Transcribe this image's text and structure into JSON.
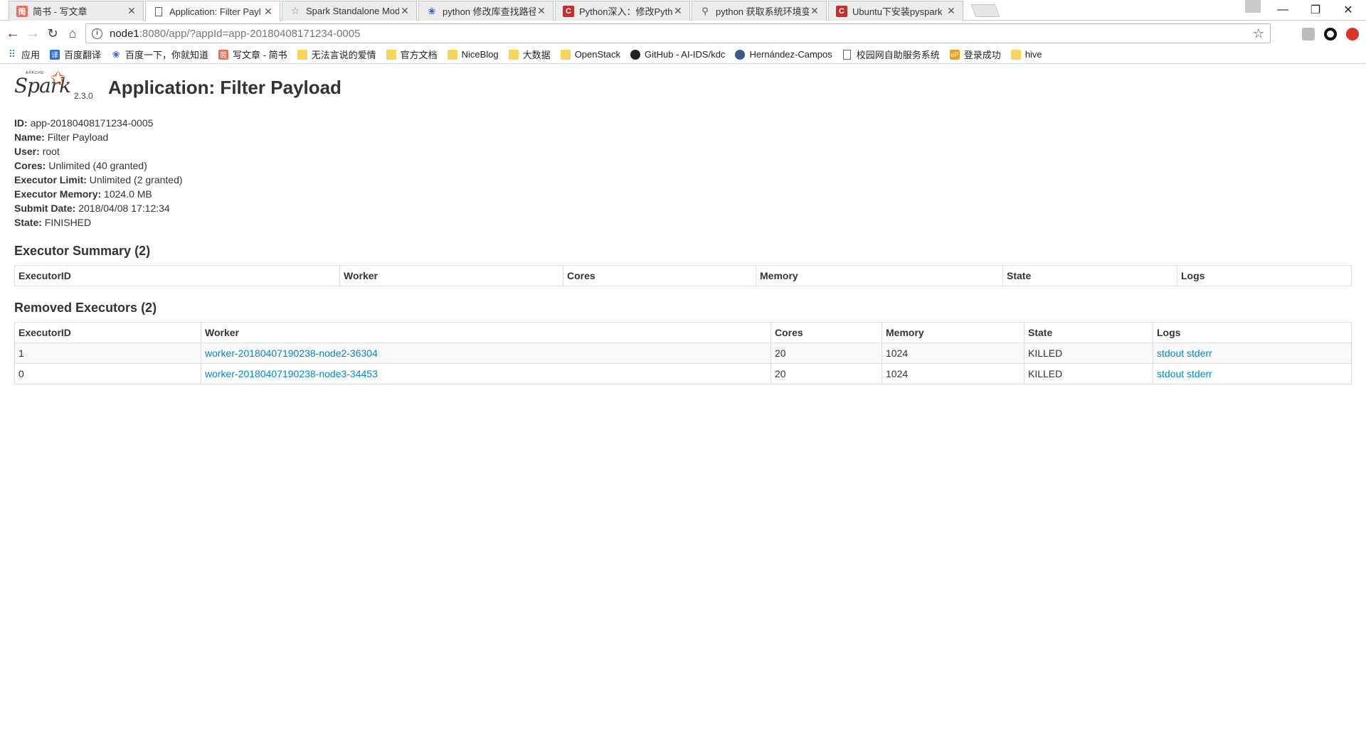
{
  "browser": {
    "tabs": [
      {
        "title": "简书 - 写文章",
        "favicon": "jianshu-icon",
        "active": false
      },
      {
        "title": "Application: Filter Payl",
        "favicon": "document-icon",
        "active": true
      },
      {
        "title": "Spark Standalone Mod",
        "favicon": "spark-star-icon",
        "active": false
      },
      {
        "title": "python 修改库查找路径",
        "favicon": "baidu-paw-icon",
        "active": false
      },
      {
        "title": "Python深入：修改Pytho",
        "favicon": "csdn-icon",
        "active": false
      },
      {
        "title": "python 获取系统环境变",
        "favicon": "link-icon",
        "active": false
      },
      {
        "title": "Ubuntu下安装pyspark",
        "favicon": "csdn-icon",
        "active": false
      }
    ],
    "url_host": "node1",
    "url_path": ":8080/app/?appId=app-20180408171234-0005",
    "bookmarks": [
      {
        "label": "应用",
        "icon": "apps-grid-icon"
      },
      {
        "label": "百度翻译",
        "icon": "baidu-translate-icon"
      },
      {
        "label": "百度一下，你就知道",
        "icon": "baidu-paw-icon"
      },
      {
        "label": "写文章 - 简书",
        "icon": "jianshu-icon"
      },
      {
        "label": "无法言说的爱情",
        "icon": "folder-icon"
      },
      {
        "label": "官方文档",
        "icon": "folder-icon"
      },
      {
        "label": "NiceBlog",
        "icon": "folder-icon"
      },
      {
        "label": "大数据",
        "icon": "folder-icon"
      },
      {
        "label": "OpenStack",
        "icon": "folder-icon"
      },
      {
        "label": "GitHub - AI-IDS/kdc",
        "icon": "github-icon"
      },
      {
        "label": "Hernández-Campos",
        "icon": "globe-icon"
      },
      {
        "label": "校园网自助服务系统",
        "icon": "document-icon"
      },
      {
        "label": "登录成功",
        "icon": "ep-icon"
      },
      {
        "label": "hive",
        "icon": "folder-icon"
      }
    ]
  },
  "app": {
    "version": "2.3.0",
    "title": "Application: Filter Payload",
    "info": [
      {
        "label": "ID:",
        "value": "app-20180408171234-0005"
      },
      {
        "label": "Name:",
        "value": "Filter Payload"
      },
      {
        "label": "User:",
        "value": "root"
      },
      {
        "label": "Cores:",
        "value": "Unlimited (40 granted)"
      },
      {
        "label": "Executor Limit:",
        "value": "Unlimited (2 granted)"
      },
      {
        "label": "Executor Memory:",
        "value": "1024.0 MB"
      },
      {
        "label": "Submit Date:",
        "value": "2018/04/08 17:12:34"
      },
      {
        "label": "State:",
        "value": "FINISHED"
      }
    ]
  },
  "executor_summary": {
    "title": "Executor Summary (2)",
    "columns": [
      "ExecutorID",
      "Worker",
      "Cores",
      "Memory",
      "State",
      "Logs"
    ]
  },
  "removed_executors": {
    "title": "Removed Executors (2)",
    "columns": [
      "ExecutorID",
      "Worker",
      "Cores",
      "Memory",
      "State",
      "Logs"
    ],
    "rows": [
      {
        "id": "1",
        "worker": "worker-20180407190238-node2-36304",
        "cores": "20",
        "memory": "1024",
        "state": "KILLED",
        "stdout": "stdout",
        "stderr": "stderr"
      },
      {
        "id": "0",
        "worker": "worker-20180407190238-node3-34453",
        "cores": "20",
        "memory": "1024",
        "state": "KILLED",
        "stdout": "stdout",
        "stderr": "stderr"
      }
    ]
  }
}
